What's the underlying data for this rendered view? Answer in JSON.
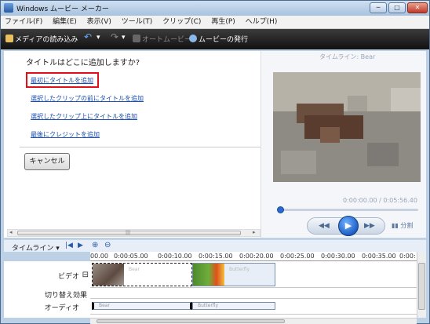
{
  "window": {
    "title": "Windows ムービー メーカー",
    "min_label": "─",
    "max_label": "□",
    "close_label": "✕"
  },
  "menu": [
    "ファイル(F)",
    "編集(E)",
    "表示(V)",
    "ツール(T)",
    "クリップ(C)",
    "再生(P)",
    "ヘルプ(H)"
  ],
  "toolbar": {
    "import_label": "メディアの読み込み",
    "undo_arrow": "▾",
    "redo_arrow": "▾",
    "automovie_label": "オートムービー",
    "publish_label": "ムービーの発行"
  },
  "title_panel": {
    "question": "タイトルはどこに追加しますか?",
    "links": [
      "最初にタイトルを追加",
      "選択したクリップの前にタイトルを追加",
      "選択したクリップ上にタイトルを追加",
      "最後にクレジットを追加"
    ],
    "cancel_label": "キャンセル"
  },
  "preview": {
    "timeline_label": "タイムライン: Bear",
    "timecode": "0:00:00.00 / 0:05:56.40",
    "seek_fraction": 0.0,
    "split_label": "分割"
  },
  "timeline": {
    "label": "タイムライン ▾",
    "ruler_ticks": [
      "00.00",
      "0:00:05.00",
      "0:00:10.00",
      "0:00:15.00",
      "0:00:20.00",
      "0:00:25.00",
      "0:00:30.00",
      "0:00:35.00",
      "0:00:"
    ],
    "tracks": {
      "video": "ビデオ",
      "video_toggle": "⊟",
      "transition": "切り替え効果",
      "audio": "オーディオ"
    },
    "clips": [
      {
        "name": "Bear"
      },
      {
        "name": "Butterfly"
      }
    ],
    "audio_clips": [
      {
        "name": "Bear"
      },
      {
        "name": "Butterfly"
      }
    ]
  },
  "colors": {
    "highlight_box": "#e0101a",
    "link": "#1a4fb0",
    "toolbar_bg": "#1f1f1f"
  }
}
